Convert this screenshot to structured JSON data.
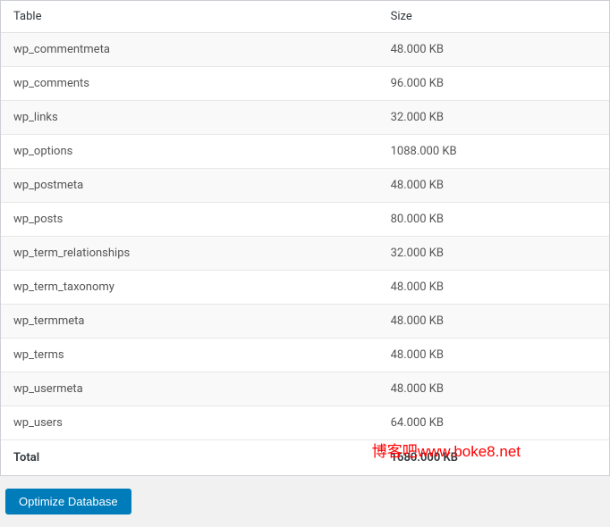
{
  "table": {
    "headers": {
      "name": "Table",
      "size": "Size"
    },
    "rows": [
      {
        "name": "wp_commentmeta",
        "size": "48.000 KB"
      },
      {
        "name": "wp_comments",
        "size": "96.000 KB"
      },
      {
        "name": "wp_links",
        "size": "32.000 KB"
      },
      {
        "name": "wp_options",
        "size": "1088.000 KB"
      },
      {
        "name": "wp_postmeta",
        "size": "48.000 KB"
      },
      {
        "name": "wp_posts",
        "size": "80.000 KB"
      },
      {
        "name": "wp_term_relationships",
        "size": "32.000 KB"
      },
      {
        "name": "wp_term_taxonomy",
        "size": "48.000 KB"
      },
      {
        "name": "wp_termmeta",
        "size": "48.000 KB"
      },
      {
        "name": "wp_terms",
        "size": "48.000 KB"
      },
      {
        "name": "wp_usermeta",
        "size": "48.000 KB"
      },
      {
        "name": "wp_users",
        "size": "64.000 KB"
      }
    ],
    "footer": {
      "label": "Total",
      "size": "1680.000 KB"
    }
  },
  "actions": {
    "optimize_label": "Optimize Database"
  },
  "watermark": "博客吧www.boke8.net"
}
